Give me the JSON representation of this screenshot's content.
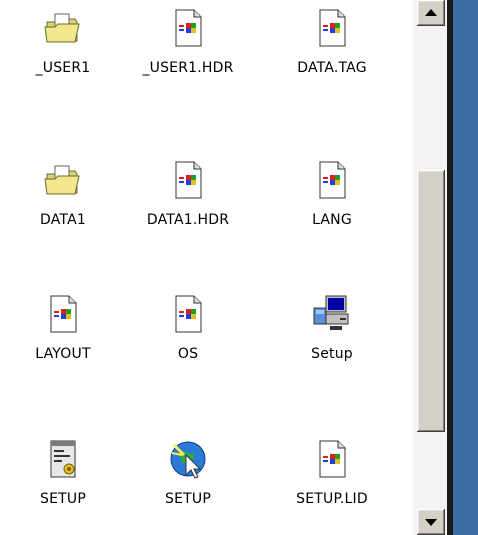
{
  "files": [
    {
      "label": "_USER1",
      "icon": "folder-icon"
    },
    {
      "label": "_USER1.HDR",
      "icon": "document-icon"
    },
    {
      "label": "DATA.TAG",
      "icon": "document-icon"
    },
    {
      "label": "DATA1",
      "icon": "folder-icon"
    },
    {
      "label": "DATA1.HDR",
      "icon": "document-icon"
    },
    {
      "label": "LANG",
      "icon": "document-icon"
    },
    {
      "label": "LAYOUT",
      "icon": "document-icon"
    },
    {
      "label": "OS",
      "icon": "document-icon"
    },
    {
      "label": "Setup",
      "icon": "setup-computer-icon"
    },
    {
      "label": "SETUP",
      "icon": "settings-file-icon"
    },
    {
      "label": "SETUP",
      "icon": "setup-globe-icon"
    },
    {
      "label": "SETUP.LID",
      "icon": "document-icon"
    }
  ],
  "colors": {
    "desktop": "#3a6ea5",
    "scrollbar": "#d4d0c8"
  }
}
